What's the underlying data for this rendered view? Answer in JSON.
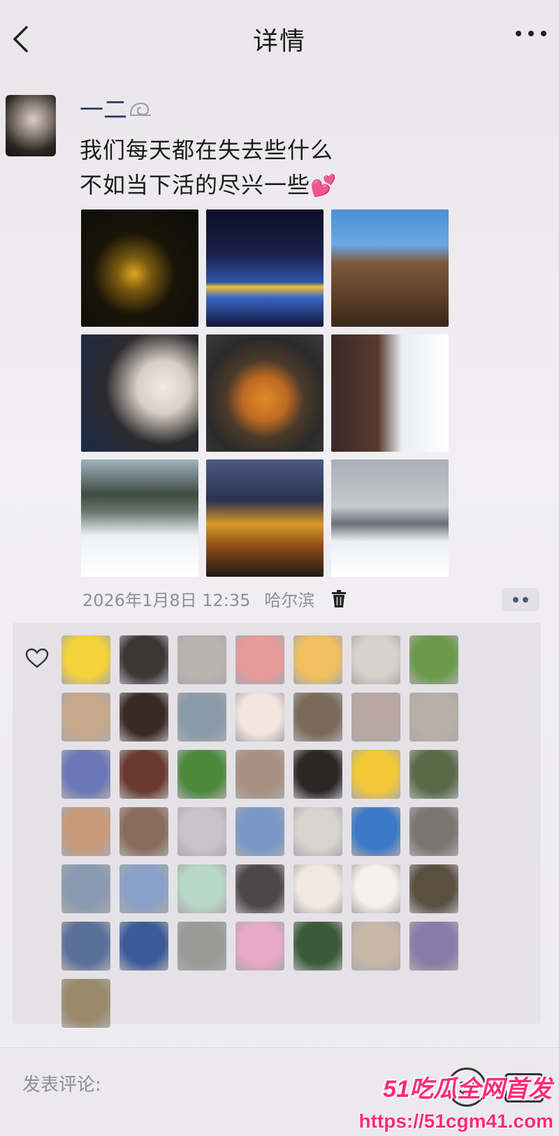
{
  "header": {
    "title": "详情"
  },
  "post": {
    "username": "一二",
    "text_line1": "我们每天都在失去些什么",
    "text_line2": "不如当下活的尽兴一些",
    "text_emoji": "💕",
    "photos": [
      {
        "name": "night-lantern-photo"
      },
      {
        "name": "ice-world-photo"
      },
      {
        "name": "cathedral-photo"
      },
      {
        "name": "selfie-mask-photo"
      },
      {
        "name": "food-dish-photo"
      },
      {
        "name": "snow-window-photo"
      },
      {
        "name": "snow-forest-photo"
      },
      {
        "name": "night-town-photo"
      },
      {
        "name": "ski-slope-photo"
      }
    ],
    "date": "2026年1月8日 12:35",
    "location": "哈尔滨"
  },
  "likes": {
    "avatar_colors": [
      "#f4d23a",
      "#3a3836",
      "#b8b4b0",
      "#e79a9a",
      "#f0c060",
      "#d8d2cc",
      "#6a9a4a",
      "#c8a88a",
      "#3a2a26",
      "#8a9aa8",
      "#f4e6de",
      "#7a6a5a",
      "#b8a8a0",
      "#b8b0a4",
      "#6a78b8",
      "#6a3a30",
      "#4a8a3a",
      "#a89080",
      "#2a2826",
      "#f0c838",
      "#5a6a48",
      "#c89a7a",
      "#8a6a5a",
      "#c8c4c8",
      "#7898c8",
      "#d8d4d0",
      "#3a78c8",
      "#7a7670",
      "#8a9ab0",
      "#8aa0c8",
      "#b8d8c8",
      "#4a4848",
      "#f2eae2",
      "#f4f0ea",
      "#5a5040",
      "#5a7098",
      "#3a5a9a",
      "#9a9a98",
      "#e8a8c8",
      "#3a5a3a",
      "#c8b8a8",
      "#8a7aa8",
      "#9a8a6a"
    ]
  },
  "comment": {
    "placeholder": "发表评论:"
  },
  "watermark": {
    "top": "51吃瓜全网首发",
    "bottom": "https://51cgm41.com"
  }
}
